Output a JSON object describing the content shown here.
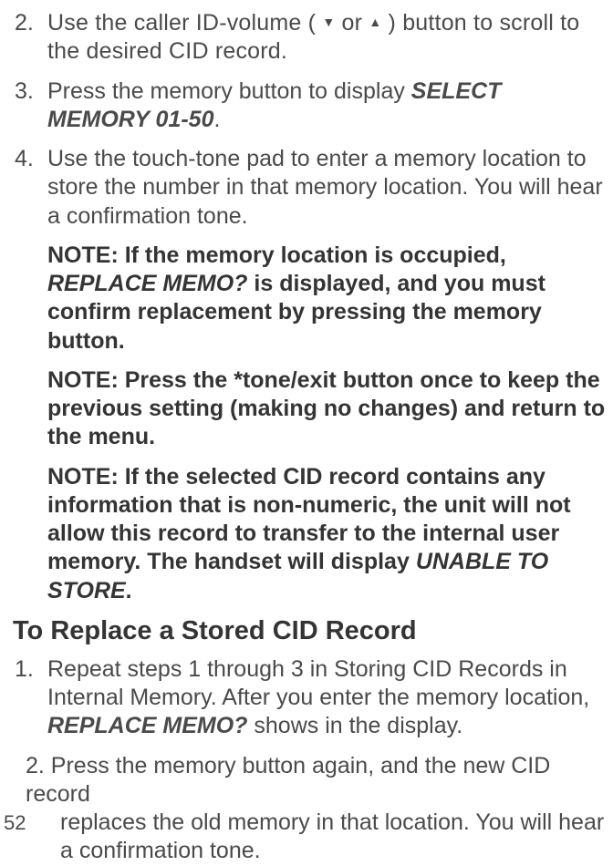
{
  "steps_a": {
    "s2": {
      "num": "2.",
      "text_a": "Use the caller ID-volume ( ",
      "icon_down": "▼",
      "text_b": " or ",
      "icon_up": "▲",
      "text_c": " ) button to scroll to the desired CID record."
    },
    "s3": {
      "num": "3.",
      "text_a": "Press the memory button to display ",
      "bi": "SELECT MEMORY 01-50",
      "text_b": "."
    },
    "s4": {
      "num": "4.",
      "text": "Use the touch-tone pad to enter a memory location to store the number in that memory location. You will hear a confirmation tone."
    }
  },
  "notes": {
    "n1": {
      "lead": "NOTE: If the memory location is occupied, ",
      "bi": "REPLACE MEMO?",
      "tail": " is displayed, and you must confirm replacement by pressing the memory button."
    },
    "n2": "NOTE: Press the *tone/exit button once to keep the previous setting (making no changes) and return to the menu.",
    "n3": {
      "lead": "NOTE: If the selected CID record contains any information that is non-numeric, the unit will not allow this record to transfer to the internal user memory. The handset will display ",
      "bi": "UNABLE TO STORE",
      "tail": "."
    }
  },
  "heading": "To Replace a Stored CID Record",
  "steps_b": {
    "s1": {
      "num": "1.",
      "text_a": "Repeat steps 1 through 3 in Storing CID Records in Internal Memory. After you enter the memory location, ",
      "bi": "REPLACE MEMO?",
      "text_b": " shows in the display."
    },
    "s2": {
      "lead": "2. Press the memory button again, and the new CID record",
      "rest": "replaces the old memory in that location. You will hear a confirmation tone."
    }
  },
  "page": "52"
}
